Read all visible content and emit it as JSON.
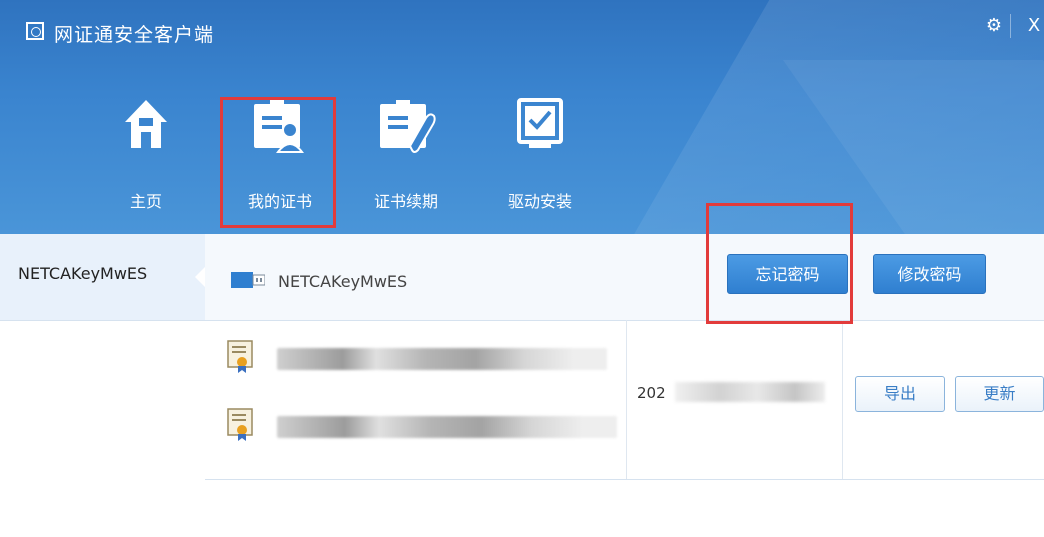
{
  "app": {
    "title": "网证通安全客户端",
    "close_symbol": "X",
    "settings_symbol": "⚙"
  },
  "nav": {
    "items": [
      {
        "label": "主页",
        "icon": "home-icon"
      },
      {
        "label": "我的证书",
        "icon": "certificate-user-icon"
      },
      {
        "label": "证书续期",
        "icon": "certificate-renew-icon"
      },
      {
        "label": "驱动安装",
        "icon": "driver-install-icon"
      }
    ]
  },
  "sidebar": {
    "items": [
      {
        "label": "NETCAKeyMwES"
      }
    ]
  },
  "device": {
    "name": "NETCAKeyMwES",
    "forgot_password_label": "忘记密码",
    "change_password_label": "修改密码"
  },
  "certificates": {
    "date_prefix": "202",
    "export_label": "导出",
    "update_label": "更新"
  },
  "colors": {
    "header_blue": "#3a84cf",
    "highlight_red": "#e23b3b",
    "button_blue": "#2f7fd0"
  }
}
